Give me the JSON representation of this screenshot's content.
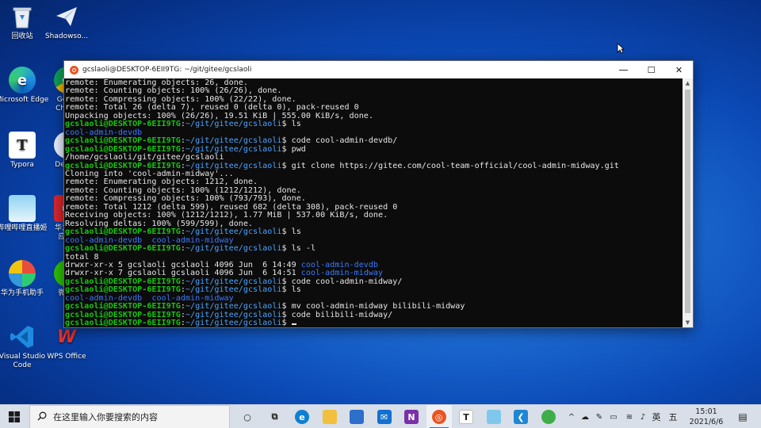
{
  "desktop": {
    "icons": [
      {
        "label": "回收站",
        "icon": "recycle-bin-icon"
      },
      {
        "label": "Shadowso...",
        "icon": "shadowsocks-icon"
      },
      {
        "label": "Microsoft Edge",
        "icon": "edge-icon"
      },
      {
        "label": "Go Chr",
        "icon": "chrome-icon"
      },
      {
        "label": "Typora",
        "icon": "typora-icon"
      },
      {
        "label": "Dec",
        "icon": "app-icon"
      },
      {
        "label": "哔哩哔哩直播姬",
        "icon": "bilibili-live-icon"
      },
      {
        "label": "华为应",
        "icon": "huawei-appgallery-icon"
      },
      {
        "label": "华为手机助手",
        "icon": "huawei-hisuite-icon"
      },
      {
        "label": "微",
        "icon": "wechat-icon"
      },
      {
        "label": "Visual Studio Code",
        "icon": "vscode-icon"
      },
      {
        "label": "WPS Office",
        "icon": "wps-icon"
      }
    ]
  },
  "terminal": {
    "title": "gcslaoli@DESKTOP-6EII9TG: ~/git/gitee/gcslaoli",
    "minimize": "—",
    "maximize": "☐",
    "close": "✕",
    "prompt_user": "gcslaoli@DESKTOP-6EII9TG",
    "prompt_path": "~/git/gitee/gcslaoli",
    "lines": [
      {
        "t": "out",
        "text": "remote: Enumerating objects: 26, done."
      },
      {
        "t": "out",
        "text": "remote: Counting objects: 100% (26/26), done."
      },
      {
        "t": "out",
        "text": "remote: Compressing objects: 100% (22/22), done."
      },
      {
        "t": "out",
        "text": "remote: Total 26 (delta 7), reused 0 (delta 0), pack-reused 0"
      },
      {
        "t": "out",
        "text": "Unpacking objects: 100% (26/26), 19.51 KiB | 555.00 KiB/s, done."
      },
      {
        "t": "cmd",
        "text": "ls"
      },
      {
        "t": "dir",
        "text": "cool-admin-devdb"
      },
      {
        "t": "cmd",
        "text": "code cool-admin-devdb/"
      },
      {
        "t": "cmd",
        "text": "pwd"
      },
      {
        "t": "out",
        "text": "/home/gcslaoli/git/gitee/gcslaoli"
      },
      {
        "t": "cmd",
        "text": "git clone https://gitee.com/cool-team-official/cool-admin-midway.git"
      },
      {
        "t": "out",
        "text": "Cloning into 'cool-admin-midway'..."
      },
      {
        "t": "out",
        "text": "remote: Enumerating objects: 1212, done."
      },
      {
        "t": "out",
        "text": "remote: Counting objects: 100% (1212/1212), done."
      },
      {
        "t": "out",
        "text": "remote: Compressing objects: 100% (793/793), done."
      },
      {
        "t": "out",
        "text": "remote: Total 1212 (delta 599), reused 682 (delta 308), pack-reused 0"
      },
      {
        "t": "out",
        "text": "Receiving objects: 100% (1212/1212), 1.77 MiB | 537.00 KiB/s, done."
      },
      {
        "t": "out",
        "text": "Resolving deltas: 100% (599/599), done."
      },
      {
        "t": "cmd",
        "text": "ls"
      },
      {
        "t": "dir",
        "text": "cool-admin-devdb  cool-admin-midway"
      },
      {
        "t": "cmd",
        "text": "ls -l"
      },
      {
        "t": "out",
        "text": "total 8"
      },
      {
        "t": "ll",
        "text": "drwxr-xr-x 5 gcslaoli gcslaoli 4096 Jun  6 14:49 ",
        "name": "cool-admin-devdb"
      },
      {
        "t": "ll",
        "text": "drwxr-xr-x 7 gcslaoli gcslaoli 4096 Jun  6 14:51 ",
        "name": "cool-admin-midway"
      },
      {
        "t": "cmd",
        "text": "code cool-admin-midway/"
      },
      {
        "t": "cmd",
        "text": "ls"
      },
      {
        "t": "dir",
        "text": "cool-admin-devdb  cool-admin-midway"
      },
      {
        "t": "cmd",
        "text": "mv cool-admin-midway bilibili-midway"
      },
      {
        "t": "cmd",
        "text": "code bilibili-midway/"
      },
      {
        "t": "cmd",
        "text": "",
        "cursor": true
      }
    ]
  },
  "taskbar": {
    "search_placeholder": "在这里输入你要搜索的内容",
    "apps": [
      {
        "icon": "cortana-icon",
        "glyph": "○",
        "color": "transparent"
      },
      {
        "icon": "task-view-icon",
        "glyph": "⧉",
        "color": "transparent"
      },
      {
        "icon": "edge-icon",
        "glyph": "e",
        "color": "#0f7fd4"
      },
      {
        "icon": "file-explorer-icon",
        "glyph": "",
        "color": "#f2c03c"
      },
      {
        "icon": "store-icon",
        "glyph": "",
        "color": "#2d6fc9"
      },
      {
        "icon": "mail-icon",
        "glyph": "✉",
        "color": "#1270cf"
      },
      {
        "icon": "onenote-icon",
        "glyph": "N",
        "color": "#7b2fa8"
      },
      {
        "icon": "ubuntu-icon",
        "glyph": "◎",
        "color": "#e95420"
      },
      {
        "icon": "typora-icon",
        "glyph": "T",
        "color": "#ffffff"
      },
      {
        "icon": "bilibili-live-icon",
        "glyph": "",
        "color": "#7fc8ec"
      },
      {
        "icon": "vscode-icon",
        "glyph": "❮",
        "color": "#1f86d6"
      },
      {
        "icon": "app-icon",
        "glyph": "",
        "color": "#3fae49"
      }
    ],
    "tray": {
      "ime": "英",
      "input_mode": "五",
      "time": "15:01",
      "date": "2021/6/6"
    }
  }
}
